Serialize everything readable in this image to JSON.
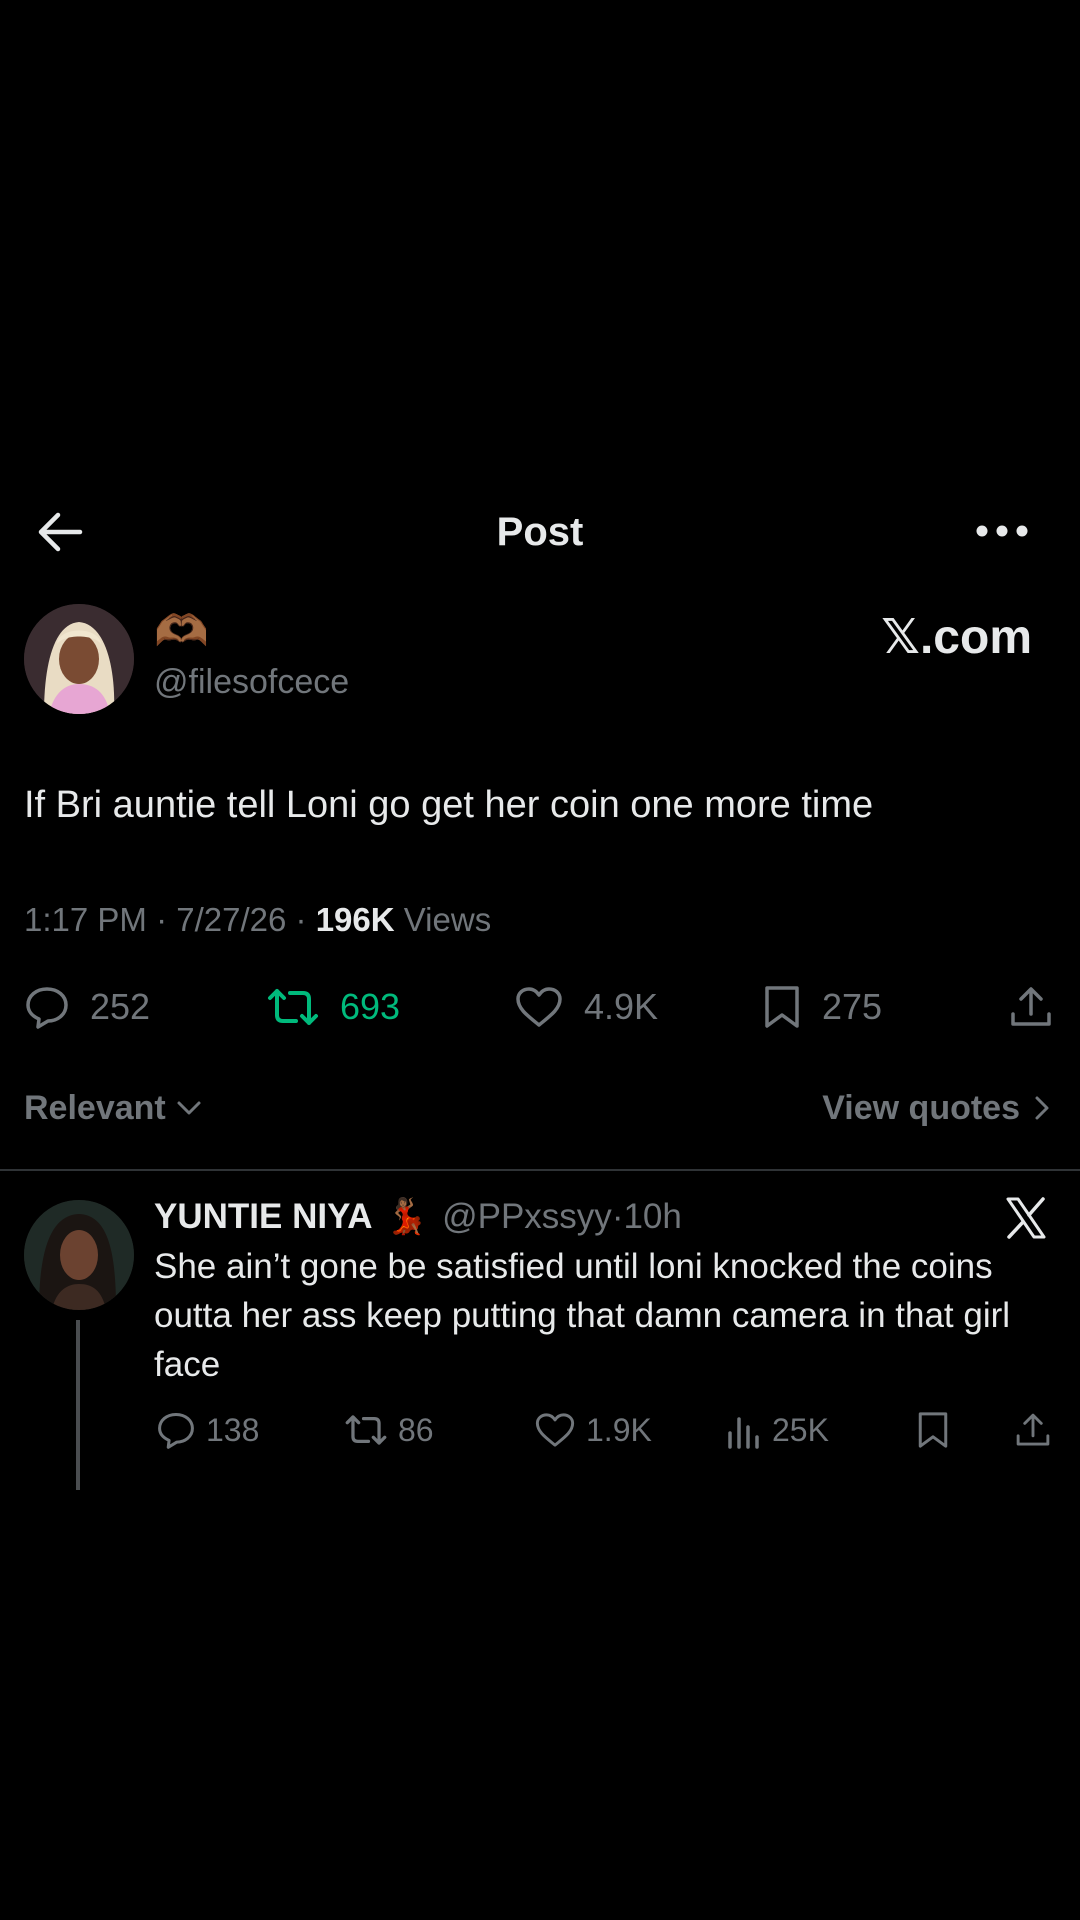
{
  "header": {
    "title": "Post"
  },
  "post": {
    "author_emoji": "🫶🏾",
    "handle": "@filesofcece",
    "watermark": "𝕏.com",
    "text": "If Bri auntie tell Loni go get her coin one more time",
    "time": "1:17 PM",
    "date": "7/27/26",
    "views_count": "196K",
    "views_label": "Views",
    "stats": {
      "replies": "252",
      "reposts": "693",
      "likes": "4.9K",
      "bookmarks": "275"
    }
  },
  "sort": {
    "relevant_label": "Relevant",
    "view_quotes_label": "View quotes"
  },
  "reply": {
    "name": "YUNTIE NIYA",
    "name_emoji": "💃🏾",
    "handle": "@PPxssyy",
    "time": "10h",
    "text": "She ain’t gone be satisfied until loni knocked the coins outta her ass keep putting that damn camera in that girl face",
    "stats": {
      "replies": "138",
      "reposts": "86",
      "likes": "1.9K",
      "views": "25K"
    }
  },
  "colors": {
    "background": "#000000",
    "text_primary": "#e7e9ea",
    "text_secondary": "#71767b",
    "repost_active": "#00ba7c",
    "divider": "#2f3336"
  },
  "icons": [
    "back-arrow-icon",
    "more-icon",
    "reply-icon",
    "repost-icon",
    "like-icon",
    "bookmark-icon",
    "share-icon",
    "chevron-down-icon",
    "chevron-right-icon",
    "x-logo-icon",
    "analytics-icon"
  ]
}
